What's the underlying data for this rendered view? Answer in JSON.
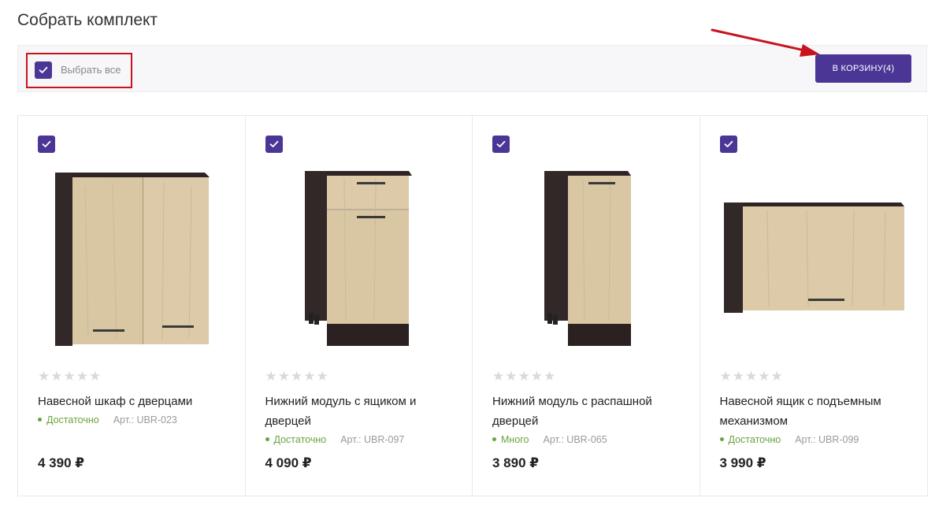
{
  "page": {
    "title": "Собрать комплект"
  },
  "toolbar": {
    "select_all_label": "Выбрать все",
    "select_all_checked": true,
    "cart_button_label": "В КОРЗИНУ(4)"
  },
  "colors": {
    "accent": "#4b3696",
    "in_stock": "#6aa33c",
    "highlight": "#c8131c",
    "arrow": "#c8131c"
  },
  "products": [
    {
      "checked": true,
      "rating_stars": "★★★★★",
      "name": "Навесной шкаф с дверцами",
      "stock": "Достаточно",
      "sku": "Арт.: UBR-023",
      "price": "4 390 ₽"
    },
    {
      "checked": true,
      "rating_stars": "★★★★★",
      "name": "Нижний модуль с ящиком и дверцей",
      "stock": "Достаточно",
      "sku": "Арт.: UBR-097",
      "price": "4 090 ₽"
    },
    {
      "checked": true,
      "rating_stars": "★★★★★",
      "name": "Нижний модуль с распашной дверцей",
      "stock": "Много",
      "sku": "Арт.: UBR-065",
      "price": "3 890 ₽"
    },
    {
      "checked": true,
      "rating_stars": "★★★★★",
      "name": "Навесной ящик с подъемным механизмом",
      "stock": "Достаточно",
      "sku": "Арт.: UBR-099",
      "price": "3 990 ₽"
    }
  ]
}
